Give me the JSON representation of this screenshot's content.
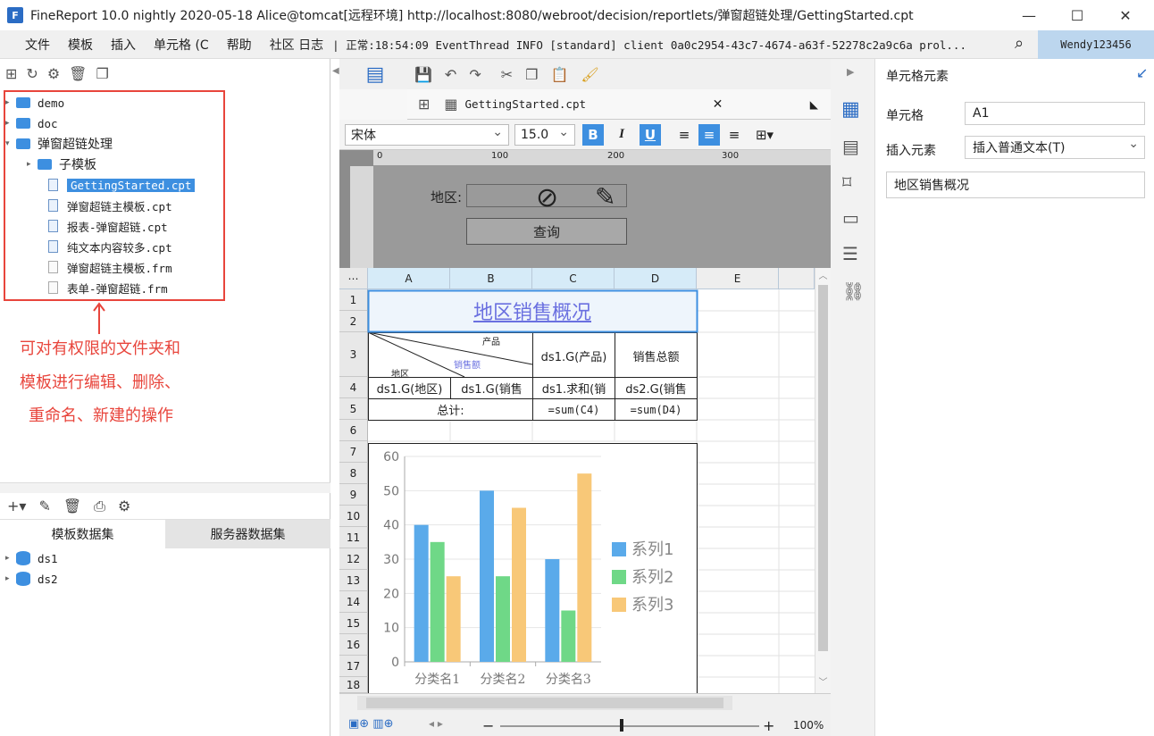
{
  "title": "FineReport 10.0 nightly 2020-05-18 Alice@tomcat[远程环境]    http://localhost:8080/webroot/decision/reportlets/弹窗超链处理/GettingStarted.cpt",
  "menu": [
    "文件",
    "模板",
    "插入",
    "单元格 (C",
    "帮助",
    "社区 日志"
  ],
  "log_text": "| 正常:18:54:09 EventThread INFO [standard] client 0a0c2954-43c7-4674-a63f-52278c2a9c6a prol...",
  "user": "Wendy123456",
  "tree": [
    {
      "label": "demo",
      "type": "folder",
      "level": 0
    },
    {
      "label": "doc",
      "type": "folder",
      "level": 0
    },
    {
      "label": "弹窗超链处理",
      "type": "folder",
      "level": 0
    },
    {
      "label": "子模板",
      "type": "folder",
      "level": 1
    },
    {
      "label": "GettingStarted.cpt",
      "type": "cpt",
      "level": 1
    },
    {
      "label": "弹窗超链主模板.cpt",
      "type": "cpt",
      "level": 1
    },
    {
      "label": "报表-弹窗超链.cpt",
      "type": "cpt",
      "level": 1
    },
    {
      "label": "纯文本内容较多.cpt",
      "type": "cpt",
      "level": 1
    },
    {
      "label": "弹窗超链主模板.frm",
      "type": "frm",
      "level": 1
    },
    {
      "label": "表单-弹窗超链.frm",
      "type": "frm",
      "level": 1
    }
  ],
  "annotation": [
    "可对有权限的文件夹和",
    "模板进行编辑、删除、",
    "重命名、新建的操作"
  ],
  "dataset_tabs": [
    "模板数据集",
    "服务器数据集"
  ],
  "datasets": [
    "ds1",
    "ds2"
  ],
  "tab_label": "GettingStarted.cpt",
  "font_name": "宋体",
  "font_size": "15.0",
  "ruler_ticks": [
    "0",
    "100",
    "200",
    "300"
  ],
  "param": {
    "label": "地区:",
    "query": "查询"
  },
  "columns": [
    "A",
    "B",
    "C",
    "D",
    "E"
  ],
  "rows": [
    "1",
    "2",
    "3",
    "4",
    "5",
    "6",
    "7",
    "8",
    "9",
    "10",
    "11",
    "12",
    "13",
    "14",
    "15",
    "16",
    "17",
    "18"
  ],
  "cells": {
    "title": "地区销售概况",
    "diag_prod": "产品",
    "diag_sales": "销售额",
    "diag_region": "地区",
    "c3": "ds1.G(产品)",
    "d3": "销售总额",
    "a4": "ds1.G(地区)",
    "b4": "ds1.G(销售",
    "c4": "ds1.求和(销",
    "d4": "ds2.G(销售",
    "a5": "总计:",
    "c5": "=sum(C4)",
    "d5": "=sum(D4)"
  },
  "chart_data": {
    "type": "bar",
    "categories": [
      "分类名1",
      "分类名2",
      "分类名3"
    ],
    "series": [
      {
        "name": "系列1",
        "values": [
          40,
          50,
          30
        ],
        "color": "#5aaaea"
      },
      {
        "name": "系列2",
        "values": [
          35,
          25,
          15
        ],
        "color": "#6fd887"
      },
      {
        "name": "系列3",
        "values": [
          25,
          45,
          55
        ],
        "color": "#f8c878"
      }
    ],
    "yticks": [
      "0",
      "10",
      "20",
      "30",
      "40",
      "50",
      "60"
    ],
    "ylim": [
      0,
      60
    ],
    "legend": "right"
  },
  "zoom": "100%",
  "right_panel": {
    "title": "单元格元素",
    "cell_label": "单元格",
    "cell_value": "A1",
    "insert_label": "插入元素",
    "insert_value": "插入普通文本(T)",
    "content": "地区销售概况"
  }
}
